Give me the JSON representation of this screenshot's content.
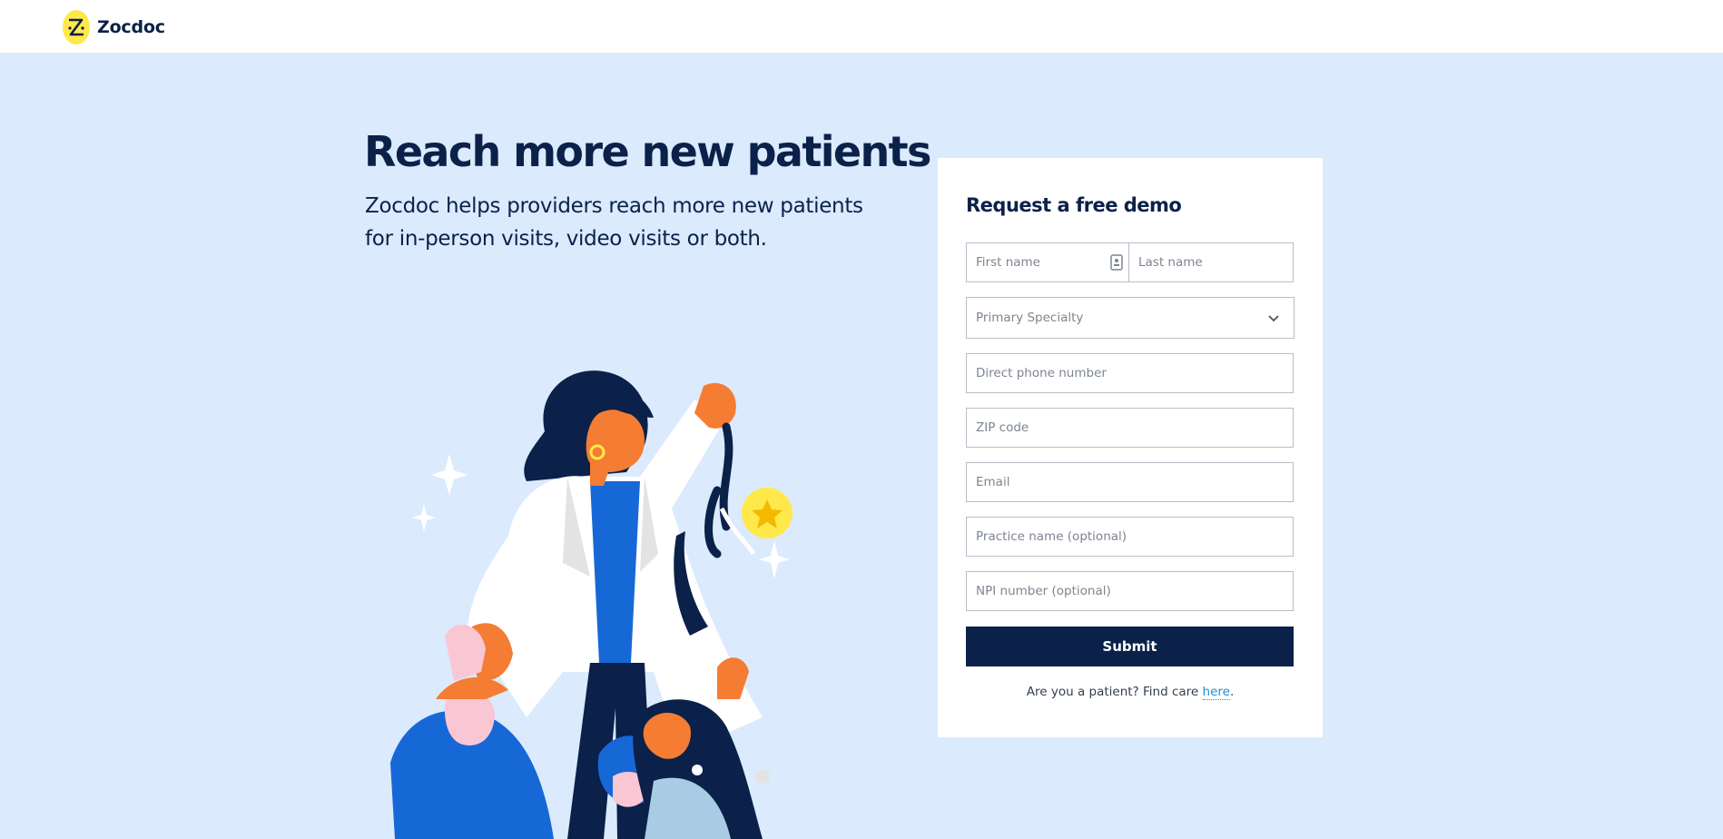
{
  "header": {
    "brand": "Zocdoc"
  },
  "hero": {
    "title": "Reach more new patients",
    "subtitle": "Zocdoc helps providers reach more new patients for in-person visits, video visits or both."
  },
  "form": {
    "title": "Request a free demo",
    "first_name_placeholder": "First name",
    "last_name_placeholder": "Last name",
    "specialty_placeholder": "Primary Specialty",
    "phone_placeholder": "Direct phone number",
    "zip_placeholder": "ZIP code",
    "email_placeholder": "Email",
    "practice_placeholder": "Practice name (optional)",
    "npi_placeholder": "NPI number (optional)",
    "submit_label": "Submit",
    "patient_prompt": "Are you a patient? Find care ",
    "patient_link": "here",
    "patient_suffix": "."
  },
  "colors": {
    "brand_yellow": "#ffe94a",
    "navy": "#0b2149",
    "background": "#dbeafc",
    "link": "#1b8fd6",
    "illustration_orange": "#f47c33",
    "illustration_blue": "#1668d6"
  },
  "icons": {
    "logo": "zocdoc-logo-icon",
    "dropdown": "chevron-down-icon",
    "autofill": "contact-card-icon"
  }
}
